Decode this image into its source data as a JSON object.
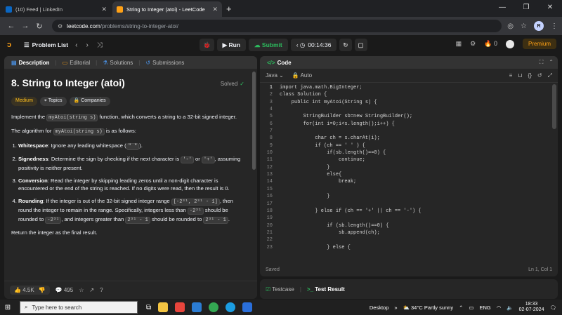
{
  "browser": {
    "tabs": [
      {
        "title": "(10) Feed | LinkedIn",
        "icon": "linkedin-icon",
        "color": "#0a66c2"
      },
      {
        "title": "String to Integer (atoi) - LeetCode",
        "icon": "leetcode-icon",
        "color": "#ffa116"
      }
    ],
    "url_host": "leetcode.com",
    "url_path": "/problems/string-to-integer-atoi/",
    "profile_initial": "R"
  },
  "lc": {
    "problem_list": "Problem List",
    "run": "Run",
    "submit": "Submit",
    "timer": "00:14:36",
    "notifications": "0",
    "premium": "Premium"
  },
  "left_tabs": [
    "Description",
    "Editorial",
    "Solutions",
    "Submissions"
  ],
  "problem": {
    "title": "8. String to Integer (atoi)",
    "status": "Solved",
    "difficulty": "Medium",
    "topics": "Topics",
    "companies": "Companies",
    "intro_pre": "Implement the ",
    "intro_code": "myAtoi(string s)",
    "intro_post": " function, which converts a string to a 32-bit signed integer.",
    "algo_pre": "The algorithm for ",
    "algo_code": "myAtoi(string s)",
    "algo_post": " is as follows:",
    "steps": [
      {
        "head": "Whitespace",
        "pre": ": Ignore any leading whitespace (",
        "code": "\" \"",
        "post": ")."
      },
      {
        "head": "Signedness",
        "pre": ": Determine the sign by checking if the next character is ",
        "code": "'-'",
        "mid": " or ",
        "code2": "'+'",
        "post": ", assuming positivity is neither present."
      },
      {
        "head": "Conversion",
        "pre": ": Read the integer by skipping leading zeros until a non-digit character is encountered or the end of the string is reached. If no digits were read, then the result is 0."
      },
      {
        "head": "Rounding",
        "pre": ": If the integer is out of the 32-bit signed integer range ",
        "code": "[-2³¹, 2³¹ - 1]",
        "mid": ", then round the integer to remain in the range. Specifically, integers less than ",
        "code2": "-2³¹",
        "mid2": " should be rounded to ",
        "code3": "-2³¹",
        "mid3": ", and integers greater than ",
        "code4": "2³¹ - 1",
        "mid4": " should be rounded to ",
        "code5": "2³¹ - 1",
        "post": "."
      }
    ],
    "return_text": "Return the integer as the final result."
  },
  "footer": {
    "likes": "4.5K",
    "comments": "495"
  },
  "editor": {
    "title": "Code",
    "language": "Java",
    "mode": "Auto",
    "status": "Saved",
    "cursor": "Ln 1, Col 1",
    "current_line": 1,
    "lines": [
      "import java.math.BigInteger;",
      "class Solution {",
      "    public int myAtoi(String s) {",
      "",
      "        StringBuilder sb=new StringBuilder();",
      "        for(int i=0;i<s.length();i++) {",
      "",
      "            char ch = s.charAt(i);",
      "            if (ch == ' ' ) {",
      "                if(sb.length()==0) {",
      "                    continue;",
      "                }",
      "                else{",
      "                    break;",
      "",
      "                }",
      "",
      "            } else if (ch == '+' || ch == '-') {",
      "",
      "                if (sb.length()==0) {",
      "                    sb.append(ch);",
      "",
      "                } else {"
    ]
  },
  "console": {
    "testcase": "Testcase",
    "result": "Test Result"
  },
  "taskbar": {
    "search_placeholder": "Type here to search",
    "desktop": "Desktop",
    "weather": "34°C  Partly sunny",
    "lang": "ENG",
    "time": "18:33",
    "date": "02-07-2024"
  }
}
